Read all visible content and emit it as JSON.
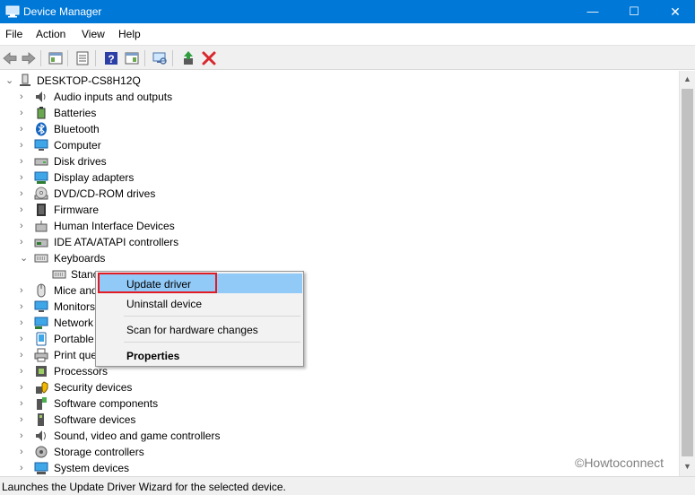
{
  "window": {
    "title": "Device Manager",
    "controls": {
      "minimize": "—",
      "maximize": "☐",
      "close": "✕"
    }
  },
  "menu": [
    "File",
    "Action",
    "View",
    "Help"
  ],
  "toolbar": {
    "icons": [
      "back-arrow-icon",
      "forward-arrow-icon",
      "show-hide-console-tree-icon",
      "properties-icon",
      "help-icon",
      "action-pane-icon",
      "scan-hardware-icon",
      "update-driver-icon",
      "uninstall-device-icon"
    ]
  },
  "tree": {
    "root": "DESKTOP-CS8H12Q",
    "categories": [
      "Audio inputs and outputs",
      "Batteries",
      "Bluetooth",
      "Computer",
      "Disk drives",
      "Display adapters",
      "DVD/CD-ROM drives",
      "Firmware",
      "Human Interface Devices",
      "IDE ATA/ATAPI controllers",
      "Keyboards",
      "Stanc",
      "Mice and",
      "Monitors",
      "Network",
      "Portable",
      "Print que",
      "Processors",
      "Security devices",
      "Software components",
      "Software devices",
      "Sound, video and game controllers",
      "Storage controllers",
      "System devices"
    ]
  },
  "context_menu": {
    "items": [
      "Update driver",
      "Uninstall device",
      "Scan for hardware changes",
      "Properties"
    ]
  },
  "status": "Launches the Update Driver Wizard for the selected device.",
  "watermark": "©Howtoconnect",
  "colors": {
    "titlebar": "#0078d7",
    "highlight": "#91c9f7",
    "annotation": "#e01b24"
  }
}
